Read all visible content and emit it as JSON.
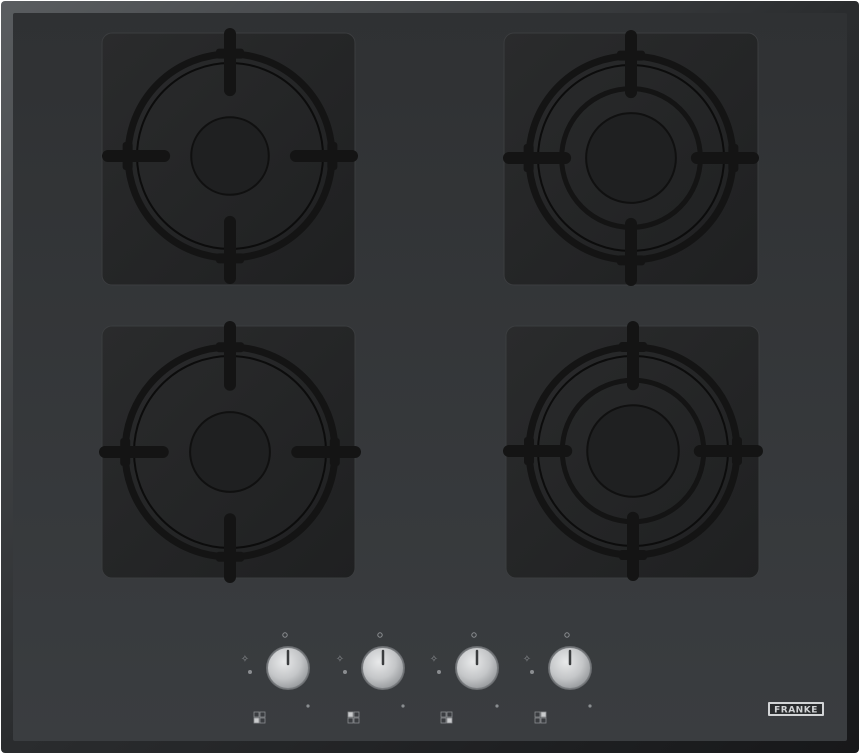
{
  "product": {
    "brand_logo": "FRANKE"
  },
  "colors": {
    "glass_top": "#2f3133",
    "glass_bottom": "#3a3d40",
    "glass_edge": "#1e1f21",
    "burner_plate": "#232425",
    "grate": "#141414",
    "burner_center": "#1f2021",
    "knob_steel_light": "#e8e9ea",
    "knob_steel_dark": "#8c8f92",
    "marking": "#8a8d90",
    "logo_plate": "#d2d4d6"
  },
  "burners": [
    {
      "name": "burner-top-left",
      "grate_style": "plus-center"
    },
    {
      "name": "burner-top-right",
      "grate_style": "ring"
    },
    {
      "name": "burner-bottom-left",
      "grate_style": "plus-center"
    },
    {
      "name": "burner-bottom-right",
      "grate_style": "ring"
    }
  ],
  "knobs": [
    {
      "name": "knob-1",
      "marker_angle_deg": 0
    },
    {
      "name": "knob-2",
      "marker_angle_deg": 0
    },
    {
      "name": "knob-3",
      "marker_angle_deg": 0
    },
    {
      "name": "knob-4",
      "marker_angle_deg": 0
    }
  ],
  "burner_position_icons": [
    {
      "name": "burner-indicator-icon-1",
      "active_cell": "bottom-left"
    },
    {
      "name": "burner-indicator-icon-2",
      "active_cell": "top-left"
    },
    {
      "name": "burner-indicator-icon-3",
      "active_cell": "bottom-right"
    },
    {
      "name": "burner-indicator-icon-4",
      "active_cell": "top-right"
    }
  ]
}
